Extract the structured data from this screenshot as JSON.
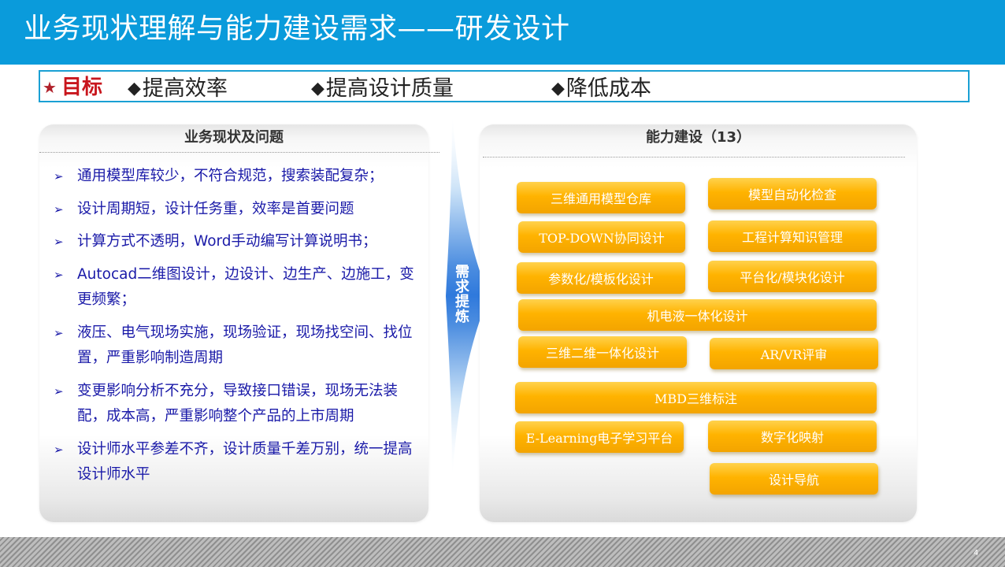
{
  "header": {
    "title": "业务现状理解与能力建设需求——研发设计"
  },
  "goals": {
    "label": "目标",
    "items": [
      "提高效率",
      "提高设计质量",
      "降低成本"
    ]
  },
  "left_panel": {
    "title": "业务现状及问题",
    "items": [
      "通用模型库较少，不符合规范，搜索装配复杂；",
      "设计周期短，设计任务重，效率是首要问题",
      "计算方式不透明，Word手动编写计算说明书；",
      "Autocad二维图设计，边设计、边生产、边施工，变更频繁；",
      "液压、电气现场实施，现场验证，现场找空间、找位置，严重影响制造周期",
      "变更影响分析不充分，导致接口错误，现场无法装配，成本高，严重影响整个产品的上市周期",
      "设计师水平参差不齐，设计质量千差万别，统一提高设计师水平"
    ]
  },
  "arrow": {
    "label": "需求提炼"
  },
  "right_panel": {
    "title": "能力建设（13）",
    "capabilities": [
      "三维通用模型仓库",
      "模型自动化检查",
      "TOP-DOWN协同设计",
      "工程计算知识管理",
      "参数化/模板化设计",
      "平台化/模块化设计",
      "机电液一体化设计",
      "三维二维一体化设计",
      "AR/VR评审",
      "MBD三维标注",
      "E-Learning电子学习平台",
      "数字化映射",
      "设计导航"
    ]
  },
  "footer": {
    "page_number": "4"
  }
}
